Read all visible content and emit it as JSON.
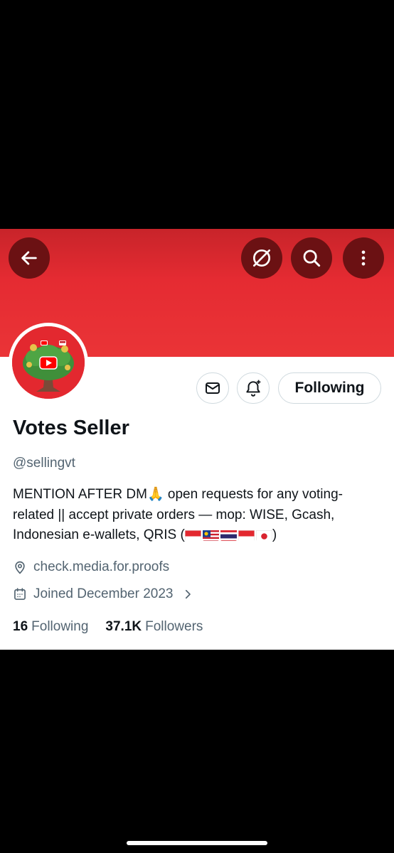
{
  "profile": {
    "name": "Votes Seller",
    "handle": "@sellingvt",
    "bio": "MENTION AFTER DM🙏 open requests for any voting-related || accept private orders  — mop: WISE, Gcash, Indonesian e-wallets, QRIS (",
    "bio_end": ")",
    "location": "check.media.for.proofs",
    "joined": "Joined December 2023",
    "following_count": "16",
    "following_label": "Following",
    "followers_count": "37.1K",
    "followers_label": "Followers",
    "follow_button_label": "Following"
  },
  "icons": {
    "back": "arrow-left-icon",
    "block": "no-symbol-icon",
    "search": "search-icon",
    "more": "vertical-dots-icon",
    "message": "envelope-icon",
    "notify": "bell-plus-icon",
    "location": "location-pin-icon",
    "calendar": "calendar-icon",
    "chevron": "chevron-right-icon"
  },
  "colors": {
    "banner": "#e52b32",
    "text_primary": "#0f1419",
    "text_secondary": "#536471"
  }
}
